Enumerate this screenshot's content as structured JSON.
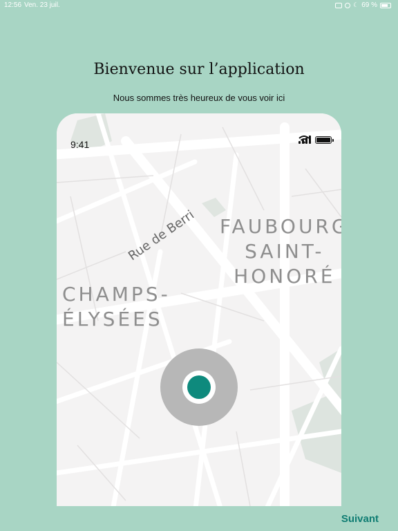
{
  "status_bar": {
    "time": "12:56",
    "date": "Ven. 23 juil.",
    "battery": "69 %"
  },
  "title": "Bienvenue sur l’application",
  "subtitle": "Nous sommes très heureux de vous voir ici",
  "phone": {
    "time": "9:41",
    "map": {
      "street": "Rue de Berri",
      "district_1_line_1": "FAUBOURG",
      "district_1_line_2": "SAINT-",
      "district_1_line_3": "HONORÉ",
      "district_2_line_1": "CHAMPS-",
      "district_2_line_2": "ÉLYSÉES"
    }
  },
  "next_label": "Suivant",
  "colors": {
    "background": "#a8d5c4",
    "accent": "#0e8a7d",
    "next": "#0e7c72"
  }
}
